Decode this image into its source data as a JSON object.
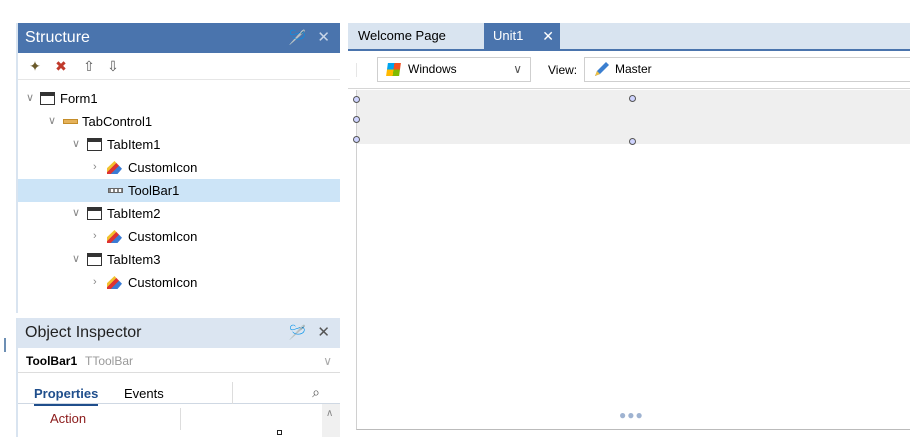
{
  "structure": {
    "title": "Structure",
    "pin_icon": "pin-icon",
    "close_icon": "close-icon",
    "toolbar": [
      "add-item-icon",
      "delete-item-icon",
      "move-up-icon",
      "move-down-icon"
    ],
    "tree": [
      {
        "label": "Form1",
        "icon": "form-icon",
        "expanded": true,
        "level": 0
      },
      {
        "label": "TabControl1",
        "icon": "tabcontrol-icon",
        "expanded": true,
        "level": 1
      },
      {
        "label": "TabItem1",
        "icon": "form-icon",
        "expanded": true,
        "level": 2
      },
      {
        "label": "CustomIcon",
        "icon": "customicon-icon",
        "expanded": false,
        "level": 3
      },
      {
        "label": "ToolBar1",
        "icon": "toolbar-icon",
        "expanded": null,
        "level": 3,
        "selected": true
      },
      {
        "label": "TabItem2",
        "icon": "form-icon",
        "expanded": true,
        "level": 2
      },
      {
        "label": "CustomIcon",
        "icon": "customicon-icon",
        "expanded": false,
        "level": 3
      },
      {
        "label": "TabItem3",
        "icon": "form-icon",
        "expanded": true,
        "level": 2
      },
      {
        "label": "CustomIcon",
        "icon": "customicon-icon",
        "expanded": false,
        "level": 3
      }
    ]
  },
  "inspector": {
    "title": "Object Inspector",
    "selected_name": "ToolBar1",
    "selected_type": "TToolBar",
    "tabs": {
      "properties": "Properties",
      "events": "Events"
    },
    "rows": [
      {
        "name": "Action"
      }
    ]
  },
  "editor": {
    "tabs": [
      {
        "label": "Welcome Page",
        "active": false
      },
      {
        "label": "Unit1",
        "active": true
      }
    ],
    "platform": "Windows",
    "view_label": "View:",
    "view_value": "Master"
  },
  "colors": {
    "accent": "#4a74ad",
    "selection": "#cce4f7"
  }
}
